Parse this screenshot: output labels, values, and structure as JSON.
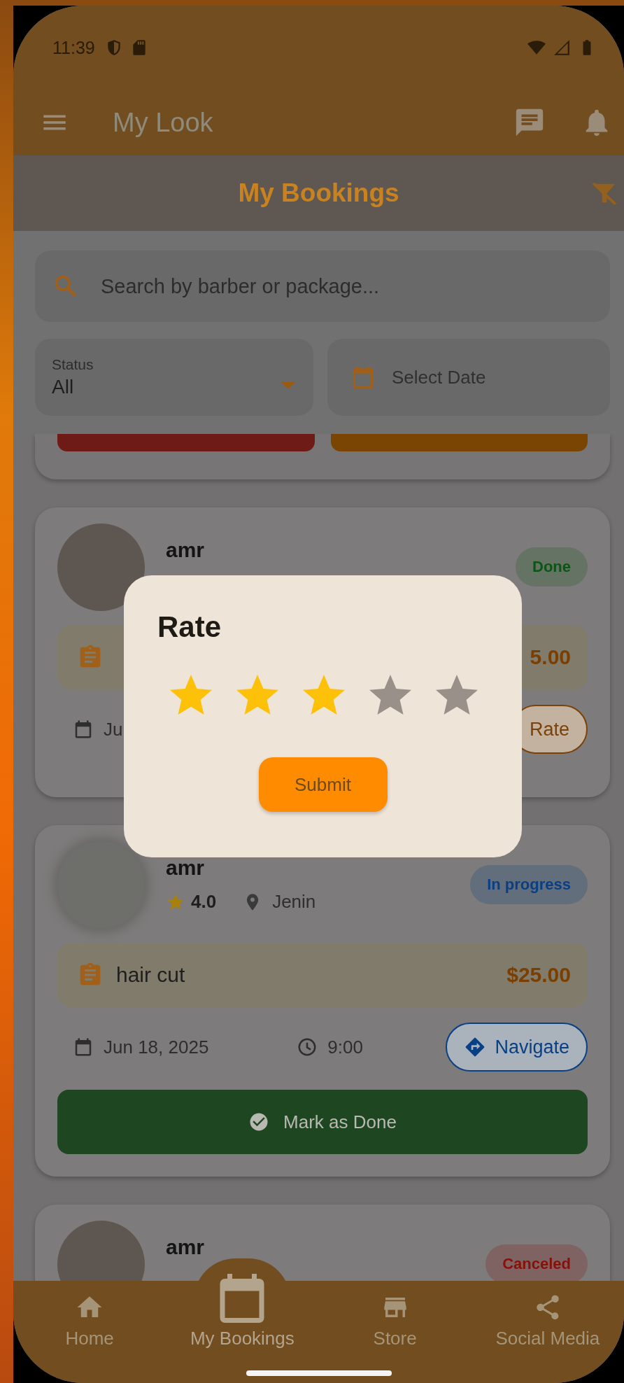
{
  "status_bar": {
    "time": "11:39"
  },
  "app_bar": {
    "title": "My Look"
  },
  "header": {
    "title": "My Bookings"
  },
  "search": {
    "placeholder": "Search by barber or package..."
  },
  "status_filter": {
    "label": "Status",
    "value": "All"
  },
  "date_filter": {
    "placeholder": "Select Date"
  },
  "cut_card": {
    "buttons": [
      {
        "color": "#6e1a17"
      },
      {
        "color": "#7a4502"
      }
    ]
  },
  "bookings": [
    {
      "has_photo": true,
      "name": "amr",
      "status": {
        "label": "Done",
        "color": "#0c5514"
      },
      "price": "5.00",
      "date": "Ju",
      "actions": [
        {
          "kind": "pill",
          "label": "Rate",
          "color": "#7a4206"
        }
      ]
    },
    {
      "has_photo": false,
      "name": "amr",
      "rating": "4.0",
      "location": "Jenin",
      "status": {
        "label": "In progress",
        "color": "#083f85"
      },
      "package": "hair cut",
      "price": "$25.00",
      "date": "Jun 18, 2025",
      "time": "9:00",
      "actions": [
        {
          "kind": "pill",
          "label": "Navigate",
          "color": "#083f85"
        },
        {
          "kind": "wide",
          "label": "Mark as Done",
          "color": "#1e4620"
        }
      ]
    },
    {
      "has_photo": true,
      "name": "amr",
      "status": {
        "label": "Canceled",
        "color": "#8a0f08"
      }
    }
  ],
  "dialog": {
    "title": "Rate",
    "stars": 3,
    "submit": "Submit"
  },
  "nav": [
    {
      "label": "Home",
      "selected": false
    },
    {
      "label": "My Bookings",
      "selected": true
    },
    {
      "label": "Store",
      "selected": false
    },
    {
      "label": "Social Media",
      "selected": false
    }
  ]
}
